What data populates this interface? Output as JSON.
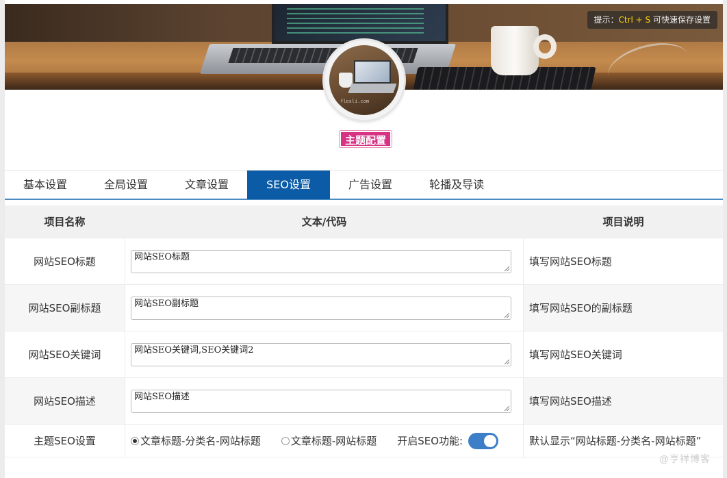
{
  "banner": {
    "hint_prefix": "提示：",
    "hint_key": "Ctrl + S",
    "hint_suffix": " 可快速保存设置"
  },
  "avatar": {
    "caption": "flesli.com"
  },
  "theme_title": "主题配置",
  "tabs": [
    {
      "label": "基本设置",
      "active": false
    },
    {
      "label": "全局设置",
      "active": false
    },
    {
      "label": "文章设置",
      "active": false
    },
    {
      "label": "SEO设置",
      "active": true
    },
    {
      "label": "广告设置",
      "active": false
    },
    {
      "label": "轮播及导读",
      "active": false
    }
  ],
  "table": {
    "headers": [
      "项目名称",
      "文本/代码",
      "项目说明"
    ],
    "rows": [
      {
        "name": "网站SEO标题",
        "value": "网站SEO标题",
        "desc": "填写网站SEO标题"
      },
      {
        "name": "网站SEO副标题",
        "value": "网站SEO副标题",
        "desc": "填写网站SEO的副标题"
      },
      {
        "name": "网站SEO关键词",
        "value": "网站SEO关键词,SEO关键词2",
        "desc": "填写网站SEO关键词"
      },
      {
        "name": "网站SEO描述",
        "value": "网站SEO描述",
        "desc": "填写网站SEO描述"
      }
    ],
    "seo_row": {
      "name": "主题SEO设置",
      "option1": "文章标题-分类名-网站标题",
      "option2": "文章标题-网站标题",
      "toggle_label": "开启SEO功能:",
      "desc": "默认显示“网站标题-分类名-网站标题”"
    }
  },
  "watermark": "@亨祥博客",
  "colors": {
    "active_tab": "#0b5ba7",
    "badge": "#d63384",
    "toggle": "#3d7ec9"
  }
}
